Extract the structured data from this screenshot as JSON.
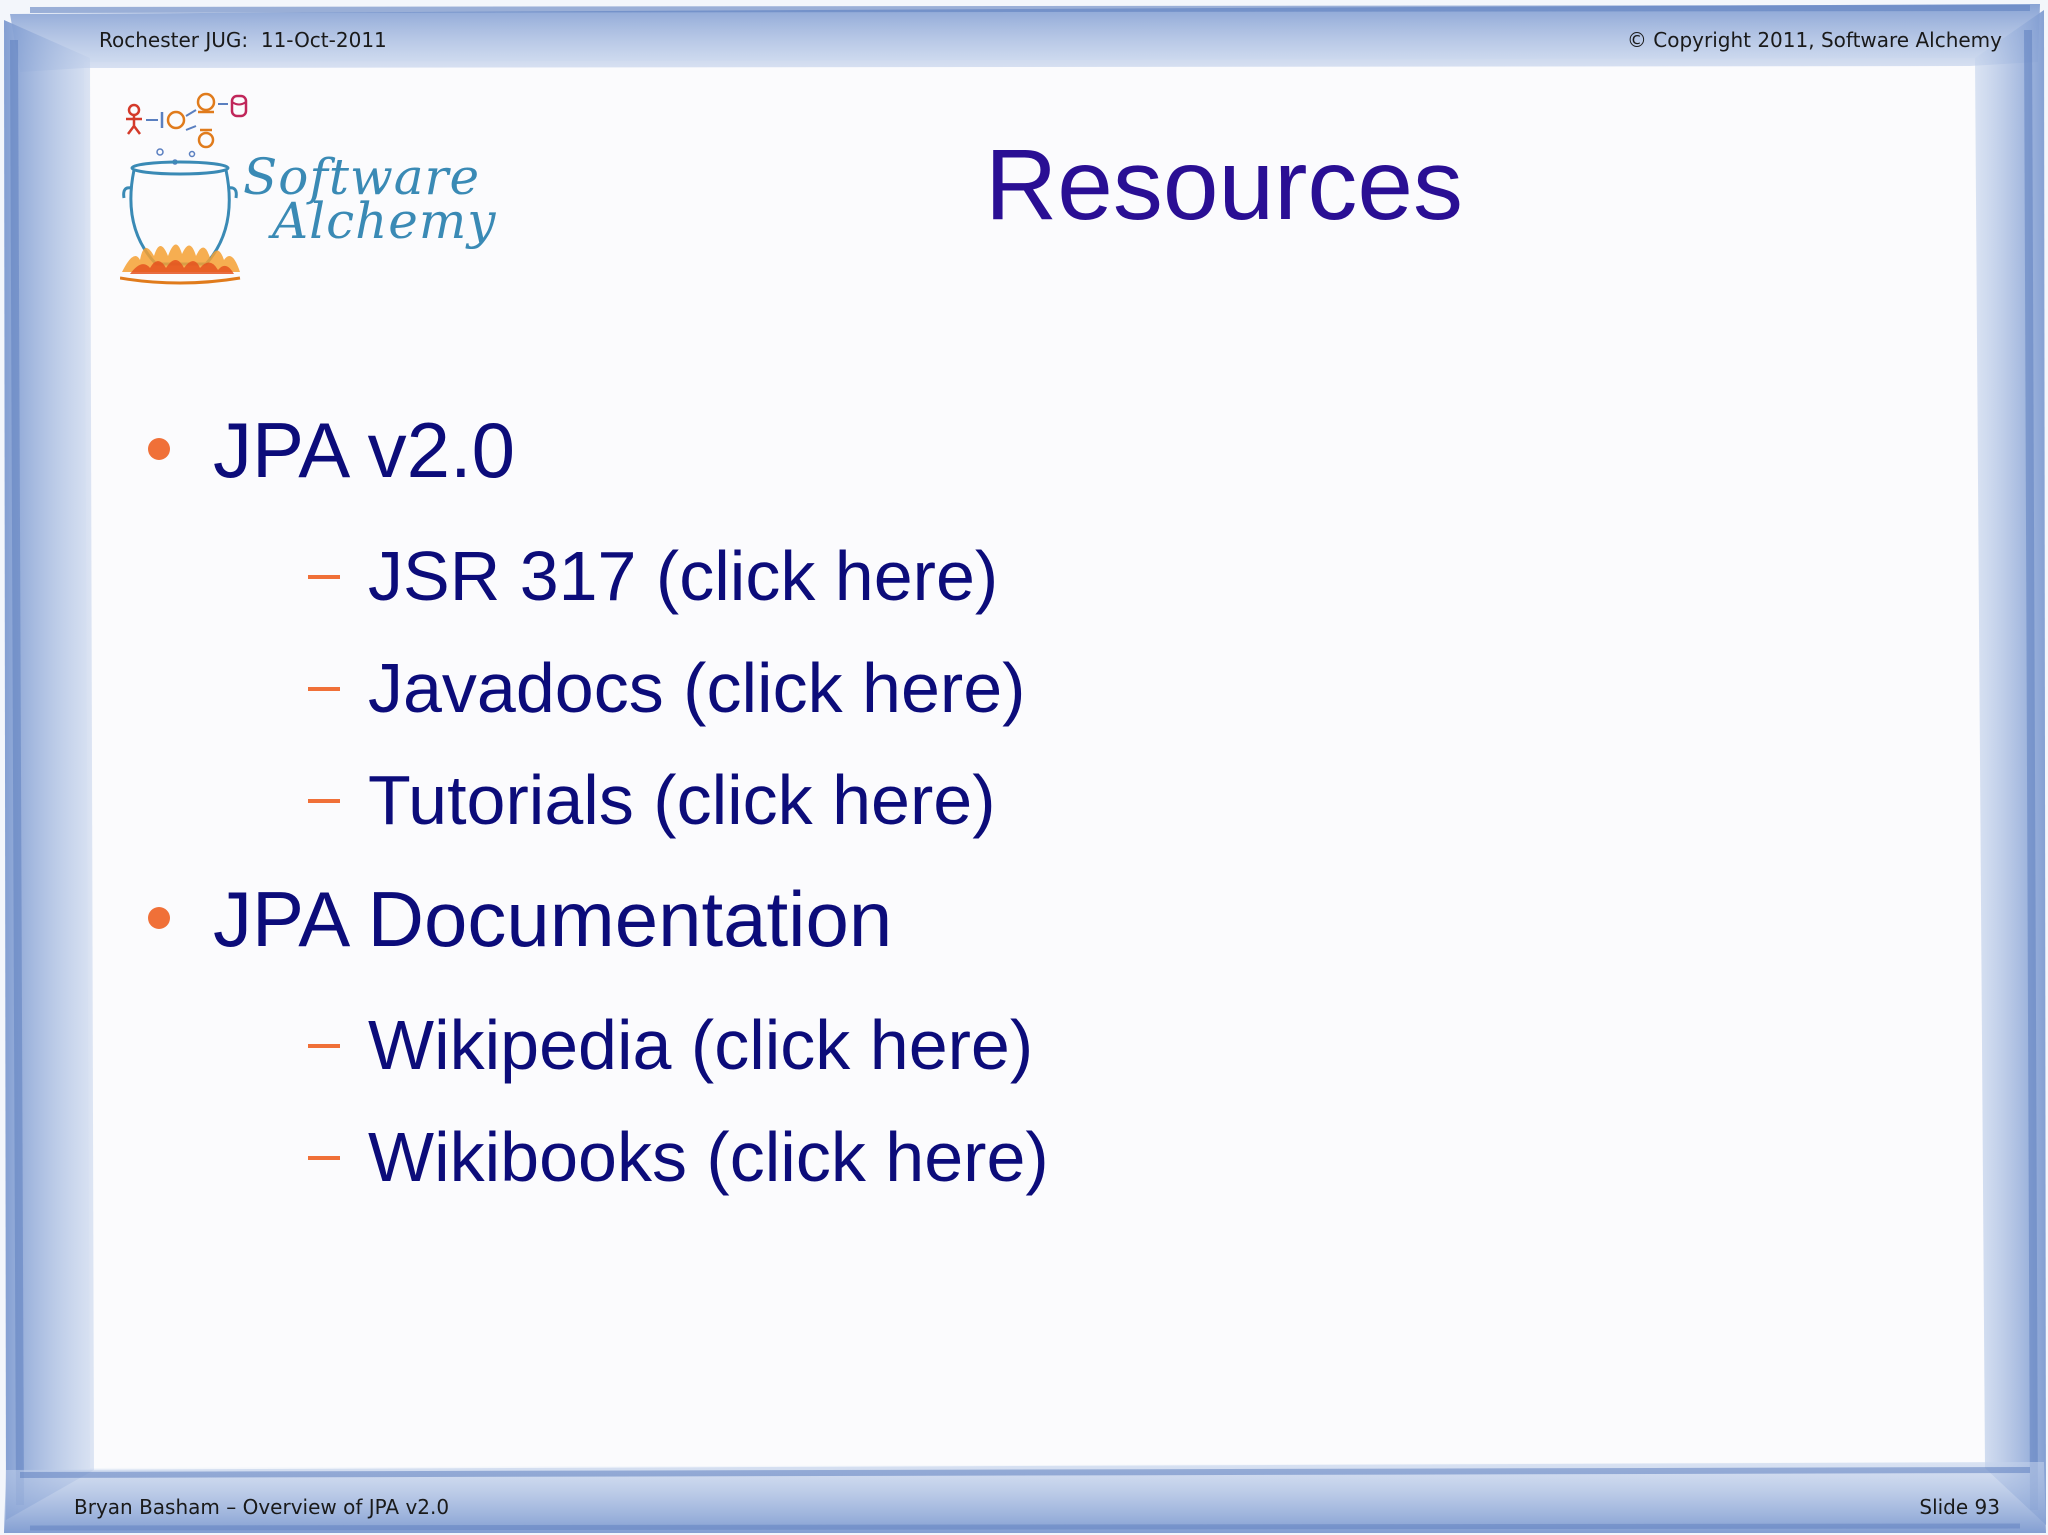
{
  "header": {
    "left": "Rochester JUG:  11-Oct-2011",
    "right": "© Copyright 2011, Software Alchemy"
  },
  "footer": {
    "left": "Bryan Basham – Overview of JPA v2.0",
    "right": "Slide 93"
  },
  "logo": {
    "line1": "Software",
    "line2": "Alchemy"
  },
  "title": "Resources",
  "sections": [
    {
      "label": "JPA v2.0",
      "items": [
        "JSR 317 (click here)",
        "Javadocs (click here)",
        "Tutorials (click here)"
      ]
    },
    {
      "label": "JPA Documentation",
      "items": [
        "Wikipedia (click here)",
        "Wikibooks (click here)"
      ]
    }
  ],
  "colors": {
    "title": "#2a0f94",
    "body_text": "#0c0c7a",
    "bullet": "#f07038",
    "frame": "#8fa9d6",
    "logo_text": "#3a8ab5"
  }
}
